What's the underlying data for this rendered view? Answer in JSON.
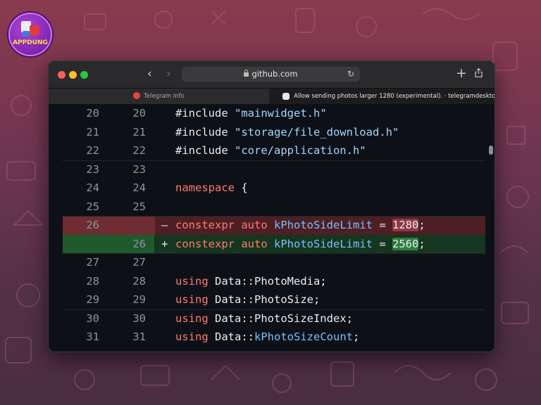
{
  "browser": {
    "address": "github.com",
    "tabs": [
      {
        "label": "Telegram Info"
      },
      {
        "label": "Allow sending photos larger 1280 (experimental). · telegramdesktop..."
      }
    ]
  },
  "logo": {
    "text": "APPDUNG"
  },
  "diff": {
    "rows": [
      {
        "old": "20",
        "new": "20",
        "sign": "",
        "type": "ctx",
        "code": "#include \"mainwidget.h\""
      },
      {
        "old": "21",
        "new": "21",
        "sign": "",
        "type": "ctx",
        "code": "#include \"storage/file_download.h\""
      },
      {
        "old": "22",
        "new": "22",
        "sign": "",
        "type": "ctx",
        "code": "#include \"core/application.h\""
      },
      {
        "old": "23",
        "new": "23",
        "sign": "",
        "type": "ctx",
        "code": ""
      },
      {
        "old": "24",
        "new": "24",
        "sign": "",
        "type": "ctx",
        "code": "namespace {"
      },
      {
        "old": "25",
        "new": "25",
        "sign": "",
        "type": "ctx",
        "code": ""
      },
      {
        "old": "26",
        "new": "",
        "sign": "–",
        "type": "del",
        "code": "constexpr auto kPhotoSideLimit = 1280;"
      },
      {
        "old": "",
        "new": "26",
        "sign": "+",
        "type": "add",
        "code": "constexpr auto kPhotoSideLimit = 2560;"
      },
      {
        "old": "27",
        "new": "27",
        "sign": "",
        "type": "ctx",
        "code": ""
      },
      {
        "old": "28",
        "new": "28",
        "sign": "",
        "type": "ctx",
        "code": "using Data::PhotoMedia;"
      },
      {
        "old": "29",
        "new": "29",
        "sign": "",
        "type": "ctx",
        "code": "using Data::PhotoSize;"
      },
      {
        "old": "30",
        "new": "30",
        "sign": "",
        "type": "ctx",
        "code": "using Data::PhotoSizeIndex;"
      },
      {
        "old": "31",
        "new": "31",
        "sign": "",
        "type": "ctx",
        "code": "using Data::kPhotoSizeCount;"
      }
    ]
  },
  "colors": {
    "deleted_gutter": "#6e2d33",
    "added_gutter": "#1f5a2c",
    "keyword": "#ff7b72",
    "string": "#a5d6ff",
    "identifier": "#79c0ff"
  }
}
